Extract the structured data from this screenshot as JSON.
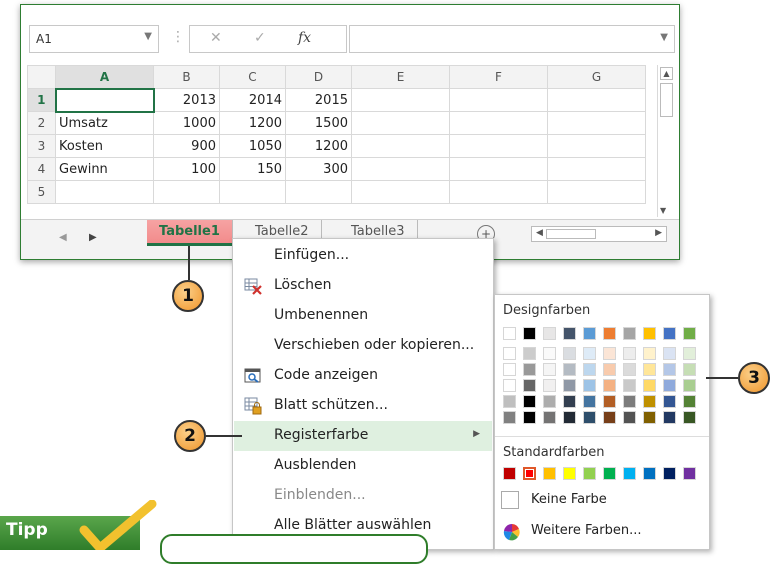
{
  "formula_bar": {
    "name_box": "A1",
    "fx_label": "fx",
    "cancel_symbol": "✕",
    "enter_symbol": "✓"
  },
  "grid": {
    "columns": [
      "A",
      "B",
      "C",
      "D",
      "E",
      "F",
      "G"
    ],
    "rows": [
      {
        "num": "1",
        "cells": [
          "",
          "2013",
          "2014",
          "2015",
          "",
          "",
          ""
        ]
      },
      {
        "num": "2",
        "cells": [
          "Umsatz",
          "1000",
          "1200",
          "1500",
          "",
          "",
          ""
        ]
      },
      {
        "num": "3",
        "cells": [
          "Kosten",
          "900",
          "1050",
          "1200",
          "",
          "",
          ""
        ]
      },
      {
        "num": "4",
        "cells": [
          "Gewinn",
          "100",
          "150",
          "300",
          "",
          "",
          ""
        ]
      },
      {
        "num": "5",
        "cells": [
          "",
          "",
          "",
          "",
          "",
          "",
          ""
        ]
      }
    ]
  },
  "sheet_tabs": {
    "tabs": [
      "Tabelle1",
      "Tabelle2",
      "Tabelle3"
    ],
    "active": "Tabelle1",
    "add_symbol": "+"
  },
  "context_menu": {
    "items": [
      {
        "label": "Einfügen...",
        "icon": "none",
        "highlighted": false,
        "disabled": false
      },
      {
        "label": "Löschen",
        "icon": "delete-sheet-icon",
        "highlighted": false,
        "disabled": false
      },
      {
        "label": "Umbenennen",
        "icon": "none",
        "highlighted": false,
        "disabled": false
      },
      {
        "label": "Verschieben oder kopieren...",
        "icon": "none",
        "highlighted": false,
        "disabled": false
      },
      {
        "label": "Code anzeigen",
        "icon": "view-code-icon",
        "highlighted": false,
        "disabled": false
      },
      {
        "label": "Blatt schützen...",
        "icon": "protect-sheet-icon",
        "highlighted": false,
        "disabled": false
      },
      {
        "label": "Registerfarbe",
        "icon": "none",
        "highlighted": true,
        "disabled": false,
        "submenu": true
      },
      {
        "label": "Ausblenden",
        "icon": "none",
        "highlighted": false,
        "disabled": false
      },
      {
        "label": "Einblenden...",
        "icon": "none",
        "highlighted": false,
        "disabled": true
      },
      {
        "label": "Alle Blätter auswählen",
        "icon": "none",
        "highlighted": false,
        "disabled": false
      }
    ]
  },
  "palette": {
    "design_title": "Designfarben",
    "standard_title": "Standardfarben",
    "no_color": "Keine Farbe",
    "more_colors": "Weitere Farben...",
    "theme_colors": [
      "#ffffff",
      "#000000",
      "#e7e6e6",
      "#44546a",
      "#5b9bd5",
      "#ed7d31",
      "#a5a5a5",
      "#ffc000",
      "#4472c4",
      "#70ad47"
    ],
    "standard_colors": [
      "#c00000",
      "#ff0000",
      "#ffc000",
      "#ffff00",
      "#92d050",
      "#00b050",
      "#00b0f0",
      "#0070c0",
      "#002060",
      "#7030a0"
    ],
    "selected_standard_index": 1
  },
  "callouts": [
    "1",
    "2",
    "3"
  ],
  "tipp": {
    "label": "Tipp"
  }
}
